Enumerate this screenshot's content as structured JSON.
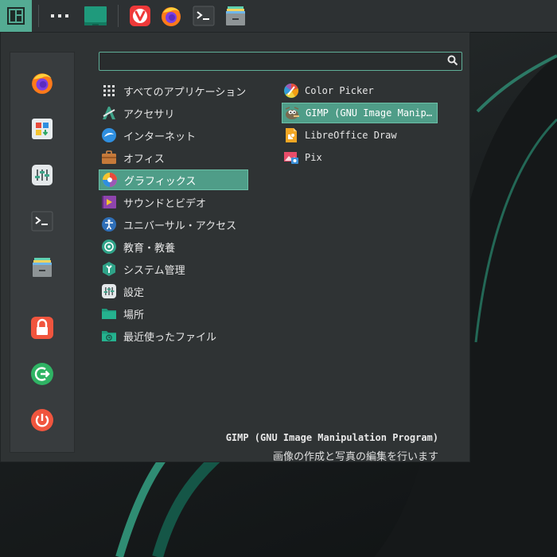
{
  "taskbar": {
    "items": [
      {
        "name": "Menu",
        "icon": "manjaro-menu-icon"
      },
      {
        "name": "Show apps",
        "icon": "dots-icon"
      },
      {
        "name": "Desktop",
        "icon": "desktop-icon"
      },
      {
        "name": "Vivaldi",
        "icon": "vivaldi-icon"
      },
      {
        "name": "Firefox",
        "icon": "firefox-icon"
      },
      {
        "name": "Terminal",
        "icon": "terminal-icon"
      },
      {
        "name": "Files",
        "icon": "file-cabinet-icon"
      }
    ]
  },
  "sidebar": {
    "items": [
      {
        "icon": "firefox-icon"
      },
      {
        "icon": "software-store-icon"
      },
      {
        "icon": "settings-sliders-icon"
      },
      {
        "icon": "terminal-icon"
      },
      {
        "icon": "file-cabinet-icon"
      },
      {
        "icon": "lock-icon"
      },
      {
        "icon": "logout-icon"
      },
      {
        "icon": "power-icon"
      }
    ]
  },
  "search": {
    "value": "",
    "placeholder": ""
  },
  "categories": [
    {
      "label": "すべてのアプリケーション",
      "icon": "grid-icon"
    },
    {
      "label": "アクセサリ",
      "icon": "accessories-icon"
    },
    {
      "label": "インターネット",
      "icon": "internet-icon"
    },
    {
      "label": "オフィス",
      "icon": "briefcase-icon"
    },
    {
      "label": "グラフィックス",
      "icon": "graphics-icon",
      "selected": true
    },
    {
      "label": "サウンドとビデオ",
      "icon": "multimedia-icon"
    },
    {
      "label": "ユニバーサル・アクセス",
      "icon": "accessibility-icon"
    },
    {
      "label": "教育・教養",
      "icon": "education-icon"
    },
    {
      "label": "システム管理",
      "icon": "system-icon"
    },
    {
      "label": "設定",
      "icon": "settings-icon"
    },
    {
      "label": "場所",
      "icon": "folder-icon"
    },
    {
      "label": "最近使ったファイル",
      "icon": "recent-folder-icon"
    }
  ],
  "apps": [
    {
      "label": "Color Picker",
      "icon": "color-picker-icon"
    },
    {
      "label": "GIMP (GNU Image Manip…",
      "icon": "gimp-icon",
      "selected": true
    },
    {
      "label": "LibreOffice Draw",
      "icon": "libreoffice-draw-icon"
    },
    {
      "label": "Pix",
      "icon": "pix-icon"
    }
  ],
  "description": {
    "title": "GIMP (GNU Image Manipulation Program)",
    "text": "画像の作成と写真の編集を行います"
  },
  "colors": {
    "accent": "#54ab93",
    "panel": "#2d3133",
    "menu_bg": "#2f3334"
  }
}
